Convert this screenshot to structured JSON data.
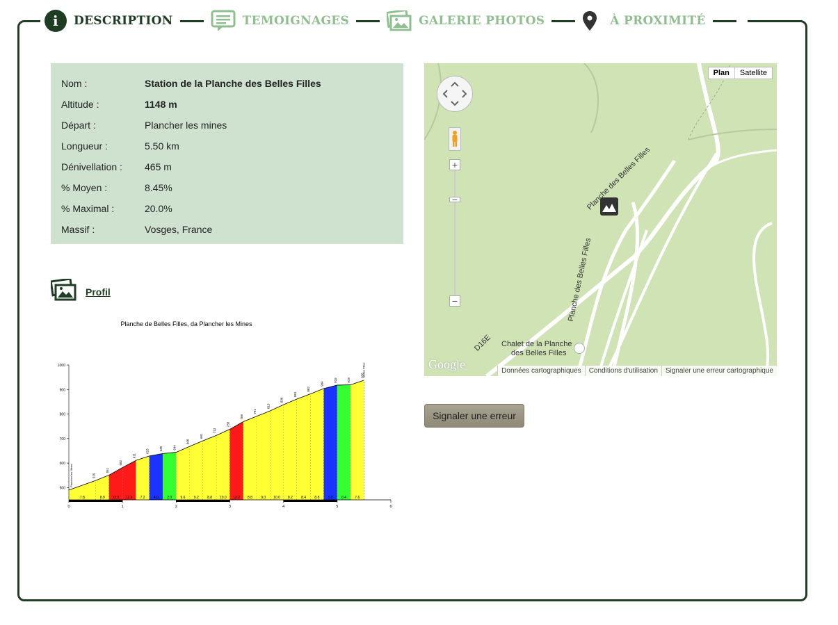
{
  "tabs": [
    {
      "label": "DESCRIPTION",
      "icon": "info-icon"
    },
    {
      "label": "TEMOIGNAGES",
      "icon": "speech-bubble-icon"
    },
    {
      "label": "GALERIE PHOTOS",
      "icon": "photos-icon"
    },
    {
      "label": "À PROXIMITÉ",
      "icon": "map-pin-icon"
    }
  ],
  "colors": {
    "accent_dark": "#1f3d23",
    "tab_inactive": "#8fbf8f",
    "info_bg": "#cfe2cf"
  },
  "info": [
    {
      "key": "Nom :",
      "value": "Station de la Planche des Belles Filles"
    },
    {
      "key": "Altitude :",
      "value": "1148 m"
    },
    {
      "key": "Départ :",
      "value": "Plancher les mines"
    },
    {
      "key": "Longueur :",
      "value": "5.50 km"
    },
    {
      "key": "Dénivellation :",
      "value": "465 m"
    },
    {
      "key": "% Moyen :",
      "value": "8.45%"
    },
    {
      "key": "% Maximal :",
      "value": "20.0%"
    },
    {
      "key": "Massif :",
      "value": "Vosges, France"
    }
  ],
  "profil": {
    "link": "Profil"
  },
  "chart_data": {
    "type": "area",
    "title": "Planche de Belles Filles, da Plancher les Mines",
    "xlabel": "",
    "ylabel": "",
    "x_ticks": [
      "0",
      "1",
      "2",
      "3",
      "4",
      "5",
      "6"
    ],
    "y_ticks": [
      "500",
      "600",
      "700",
      "800",
      "900",
      "1000"
    ],
    "xlim": [
      0,
      6
    ],
    "ylim": [
      450,
      1000
    ],
    "start_label": "Plancher les Mines",
    "end_label": "Belles Filles",
    "segments": [
      {
        "x0": 0.0,
        "x1": 0.5,
        "grade": "7.8",
        "color": "#ffff33"
      },
      {
        "x0": 0.5,
        "x1": 0.75,
        "grade": "8.9",
        "color": "#ffff33"
      },
      {
        "x0": 0.75,
        "x1": 1.0,
        "grade": "12.5",
        "color": "#ff1a1a"
      },
      {
        "x0": 1.0,
        "x1": 1.25,
        "grade": "11.6",
        "color": "#ff1a1a"
      },
      {
        "x0": 1.25,
        "x1": 1.5,
        "grade": "7.2",
        "color": "#ffff33"
      },
      {
        "x0": 1.5,
        "x1": 1.75,
        "grade": "4.0",
        "color": "#1a33ff"
      },
      {
        "x0": 1.75,
        "x1": 2.0,
        "grade": "2.0",
        "color": "#33ff33"
      },
      {
        "x0": 2.0,
        "x1": 2.25,
        "grade": "9.6",
        "color": "#ffff33"
      },
      {
        "x0": 2.25,
        "x1": 2.5,
        "grade": "9.2",
        "color": "#ffff33"
      },
      {
        "x0": 2.5,
        "x1": 2.75,
        "grade": "8.8",
        "color": "#ffff33"
      },
      {
        "x0": 2.75,
        "x1": 3.0,
        "grade": "10.0",
        "color": "#ffff33"
      },
      {
        "x0": 3.0,
        "x1": 3.25,
        "grade": "12.2",
        "color": "#ff1a1a"
      },
      {
        "x0": 3.25,
        "x1": 3.5,
        "grade": "8.8",
        "color": "#ffff33"
      },
      {
        "x0": 3.5,
        "x1": 3.75,
        "grade": "9.0",
        "color": "#ffff33"
      },
      {
        "x0": 3.75,
        "x1": 4.0,
        "grade": "10.0",
        "color": "#ffff33"
      },
      {
        "x0": 4.0,
        "x1": 4.25,
        "grade": "9.2",
        "color": "#ffff33"
      },
      {
        "x0": 4.25,
        "x1": 4.5,
        "grade": "8.4",
        "color": "#ffff33"
      },
      {
        "x0": 4.5,
        "x1": 4.75,
        "grade": "8.8",
        "color": "#ffff33"
      },
      {
        "x0": 4.75,
        "x1": 5.0,
        "grade": "5.6",
        "color": "#1a33ff"
      },
      {
        "x0": 5.0,
        "x1": 5.25,
        "grade": "0.4",
        "color": "#33ff33"
      },
      {
        "x0": 5.25,
        "x1": 5.5,
        "grade": "7.6",
        "color": "#ffff33"
      }
    ],
    "profile": [
      {
        "x": 0.0,
        "y": 490
      },
      {
        "x": 0.5,
        "y": 529
      },
      {
        "x": 0.75,
        "y": 551
      },
      {
        "x": 1.0,
        "y": 582
      },
      {
        "x": 1.25,
        "y": 611
      },
      {
        "x": 1.5,
        "y": 629
      },
      {
        "x": 1.75,
        "y": 639
      },
      {
        "x": 2.0,
        "y": 644
      },
      {
        "x": 2.25,
        "y": 668
      },
      {
        "x": 2.5,
        "y": 691
      },
      {
        "x": 2.75,
        "y": 713
      },
      {
        "x": 3.0,
        "y": 738
      },
      {
        "x": 3.25,
        "y": 769
      },
      {
        "x": 3.5,
        "y": 791
      },
      {
        "x": 3.75,
        "y": 813
      },
      {
        "x": 4.0,
        "y": 838
      },
      {
        "x": 4.25,
        "y": 861
      },
      {
        "x": 4.5,
        "y": 882
      },
      {
        "x": 4.75,
        "y": 904
      },
      {
        "x": 5.0,
        "y": 918
      },
      {
        "x": 5.25,
        "y": 919
      },
      {
        "x": 5.5,
        "y": 938
      }
    ]
  },
  "map": {
    "type_plan": "Plan",
    "type_satellite": "Satellite",
    "labels": [
      "Planche des Belles Filles",
      "Planche des Belles Filles",
      "D16E",
      "Chalet de la Planche",
      "des Belles Filles"
    ],
    "logo": "Google",
    "footer": [
      "Données cartographiques",
      "Conditions d'utilisation",
      "Signaler une erreur cartographique"
    ]
  },
  "report_button": "Signaler une erreur"
}
